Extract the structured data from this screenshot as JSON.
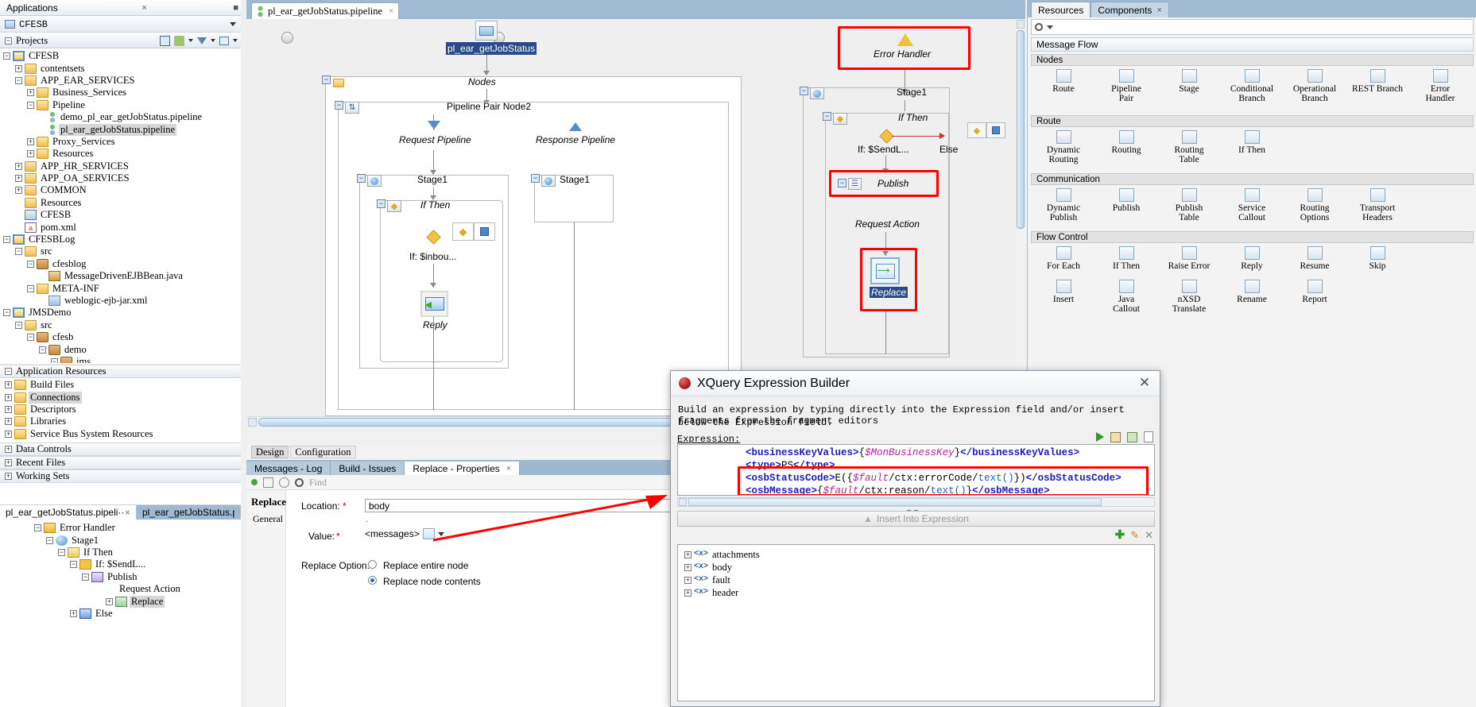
{
  "app": {
    "panel_title": "Applications",
    "selected_application": "CFESB",
    "projects_label": "Projects",
    "toolbar_icons": [
      "search-icon",
      "refresh-icon",
      "filter-icon",
      "view-options-icon"
    ]
  },
  "project_tree": [
    {
      "depth": 0,
      "exp": "-",
      "icon": "project-icon",
      "label": "CFESB",
      "selected": false
    },
    {
      "depth": 1,
      "exp": "+",
      "icon": "folder-icon",
      "label": "contentsets",
      "selected": false
    },
    {
      "depth": 1,
      "exp": "-",
      "icon": "folder-icon",
      "label": "APP_EAR_SERVICES",
      "selected": false
    },
    {
      "depth": 2,
      "exp": "+",
      "icon": "folder-icon",
      "label": "Business_Services",
      "selected": false
    },
    {
      "depth": 2,
      "exp": "-",
      "icon": "folder-icon",
      "label": "Pipeline",
      "selected": false
    },
    {
      "depth": 3,
      "exp": "",
      "icon": "pipeline-file-icon",
      "label": "demo_pl_ear_getJobStatus.pipeline",
      "selected": false
    },
    {
      "depth": 3,
      "exp": "",
      "icon": "pipeline-file-icon",
      "label": "pl_ear_getJobStatus.pipeline",
      "selected": true
    },
    {
      "depth": 2,
      "exp": "+",
      "icon": "folder-icon",
      "label": "Proxy_Services",
      "selected": false
    },
    {
      "depth": 2,
      "exp": "+",
      "icon": "folder-icon",
      "label": "Resources",
      "selected": false
    },
    {
      "depth": 1,
      "exp": "+",
      "icon": "folder-icon",
      "label": "APP_HR_SERVICES",
      "selected": false
    },
    {
      "depth": 1,
      "exp": "+",
      "icon": "folder-icon",
      "label": "APP_OA_SERVICES",
      "selected": false
    },
    {
      "depth": 1,
      "exp": "+",
      "icon": "folder-icon",
      "label": "COMMON",
      "selected": false
    },
    {
      "depth": 1,
      "exp": "",
      "icon": "folder-icon",
      "label": "Resources",
      "selected": false
    },
    {
      "depth": 1,
      "exp": "",
      "icon": "servicebus-icon",
      "label": "CFESB",
      "selected": false
    },
    {
      "depth": 1,
      "exp": "",
      "icon": "maven-icon",
      "label": "pom.xml",
      "selected": false
    },
    {
      "depth": 0,
      "exp": "-",
      "icon": "project-icon",
      "label": "CFESBLog",
      "selected": false
    },
    {
      "depth": 1,
      "exp": "-",
      "icon": "folder-icon",
      "label": "src",
      "selected": false
    },
    {
      "depth": 2,
      "exp": "-",
      "icon": "package-icon",
      "label": "cfesblog",
      "selected": false
    },
    {
      "depth": 3,
      "exp": "",
      "icon": "java-icon",
      "label": "MessageDrivenEJBBean.java",
      "selected": false
    },
    {
      "depth": 2,
      "exp": "-",
      "icon": "folder-icon",
      "label": "META-INF",
      "selected": false
    },
    {
      "depth": 3,
      "exp": "",
      "icon": "xml-icon",
      "label": "weblogic-ejb-jar.xml",
      "selected": false
    },
    {
      "depth": 0,
      "exp": "-",
      "icon": "project-icon",
      "label": "JMSDemo",
      "selected": false
    },
    {
      "depth": 1,
      "exp": "-",
      "icon": "folder-icon",
      "label": "src",
      "selected": false
    },
    {
      "depth": 2,
      "exp": "-",
      "icon": "package-icon",
      "label": "cfesb",
      "selected": false
    },
    {
      "depth": 3,
      "exp": "-",
      "icon": "package-icon",
      "label": "demo",
      "selected": false
    },
    {
      "depth": 4,
      "exp": "-",
      "icon": "package-icon",
      "label": "jms",
      "selected": false
    }
  ],
  "app_resources": {
    "title": "Application Resources",
    "items": [
      {
        "exp": "+",
        "icon": "folder-icon",
        "label": "Build Files",
        "selected": false
      },
      {
        "exp": "+",
        "icon": "folder-icon",
        "label": "Connections",
        "selected": true
      },
      {
        "exp": "+",
        "icon": "folder-icon",
        "label": "Descriptors",
        "selected": false
      },
      {
        "exp": "+",
        "icon": "folder-icon",
        "label": "Libraries",
        "selected": false
      },
      {
        "exp": "+",
        "icon": "folder-icon",
        "label": "Service Bus System Resources",
        "selected": false
      }
    ]
  },
  "collapsed_panels": [
    "Data Controls",
    "Recent Files",
    "Working Sets"
  ],
  "structure": {
    "tabs": [
      {
        "label": "pl_ear_getJobStatus.pipeli···",
        "active": true,
        "closable": true
      },
      {
        "label": "pl_ear_getJobStatus.pipeline···",
        "active": false,
        "closable": false
      }
    ],
    "nodes": [
      {
        "depth": 1,
        "exp": "-",
        "icon": "error-handler-icon",
        "label": "Error Handler",
        "selected": false
      },
      {
        "depth": 2,
        "exp": "-",
        "icon": "stage-icon",
        "label": "Stage1",
        "selected": false
      },
      {
        "depth": 3,
        "exp": "-",
        "icon": "if-then-icon",
        "label": "If Then",
        "selected": false
      },
      {
        "depth": 4,
        "exp": "-",
        "icon": "condition-icon",
        "label": "If: $SendL...",
        "selected": false
      },
      {
        "depth": 5,
        "exp": "-",
        "icon": "publish-icon",
        "label": "Publish",
        "selected": false
      },
      {
        "depth": 6,
        "exp": "",
        "icon": "",
        "label": "Request Action",
        "selected": false
      },
      {
        "depth": 7,
        "exp": "+",
        "icon": "replace-icon",
        "label": "Replace",
        "selected": true
      },
      {
        "depth": 4,
        "exp": "+",
        "icon": "else-icon",
        "label": "Else",
        "selected": false
      }
    ]
  },
  "editor": {
    "tab_label": "pl_ear_getJobStatus.pipeline",
    "tab_icon": "pipeline-file-icon",
    "design_tabs": [
      {
        "label": "Design",
        "active": true
      },
      {
        "label": "Configuration",
        "active": false
      }
    ]
  },
  "diagram": {
    "service_name": "pl_ear_getJobStatus",
    "nodes_label": "Nodes",
    "pipeline_pair_label": "Pipeline Pair Node2",
    "request_pipeline_label": "Request Pipeline",
    "response_pipeline_label": "Response Pipeline",
    "request_stage_label": "Stage1",
    "response_stage_label": "Stage1",
    "if_then_label": "If Then",
    "if_condition_label": "If: $inbou...",
    "reply_label": "Reply",
    "error_handler_label": "Error Handler",
    "eh_stage_label": "Stage1",
    "eh_if_then_label": "If Then",
    "eh_if_condition_label": "If: $SendL...",
    "eh_else_label": "Else",
    "eh_publish_label": "Publish",
    "eh_request_action_label": "Request Action",
    "eh_replace_label": "Replace",
    "highlight_color": "#ff0000"
  },
  "properties": {
    "tabs": [
      {
        "label": "Messages - Log",
        "active": false
      },
      {
        "label": "Build - Issues",
        "active": false
      },
      {
        "label": "Replace - Properties",
        "active": true
      }
    ],
    "find_placeholder": "Find",
    "section_title": "Replace",
    "side_tab": "General",
    "location_label": "Location:",
    "location_required": "*",
    "location_value": "body",
    "value_label": "Value:",
    "value_required": "*",
    "value_content": "<messages>",
    "replace_option_label": "Replace Option:",
    "options": [
      {
        "label": "Replace entire node",
        "selected": false
      },
      {
        "label": "Replace node contents",
        "selected": true
      }
    ]
  },
  "palette": {
    "tabs": [
      {
        "label": "Resources",
        "active": true
      },
      {
        "label": "Components",
        "active": false
      }
    ],
    "search_placeholder": "",
    "section_title": "Message Flow",
    "categories": [
      {
        "name": "Nodes",
        "items": [
          {
            "label": "Route",
            "icon": "route-icon"
          },
          {
            "label": "Pipeline\nPair",
            "icon": "pipeline-pair-icon"
          },
          {
            "label": "Stage",
            "icon": "stage-icon"
          },
          {
            "label": "Conditional\nBranch",
            "icon": "conditional-branch-icon"
          },
          {
            "label": "Operational\nBranch",
            "icon": "operational-branch-icon"
          },
          {
            "label": "REST Branch",
            "icon": "rest-branch-icon"
          },
          {
            "label": "Error\nHandler",
            "icon": "error-handler-icon"
          }
        ]
      },
      {
        "name": "Route",
        "items": [
          {
            "label": "Dynamic\nRouting",
            "icon": "dynamic-routing-icon"
          },
          {
            "label": "Routing",
            "icon": "routing-icon"
          },
          {
            "label": "Routing\nTable",
            "icon": "routing-table-icon"
          },
          {
            "label": "If Then",
            "icon": "if-then-icon"
          }
        ]
      },
      {
        "name": "Communication",
        "items": [
          {
            "label": "Dynamic\nPublish",
            "icon": "dynamic-publish-icon"
          },
          {
            "label": "Publish",
            "icon": "publish-icon"
          },
          {
            "label": "Publish\nTable",
            "icon": "publish-table-icon"
          },
          {
            "label": "Service\nCallout",
            "icon": "service-callout-icon"
          },
          {
            "label": "Routing\nOptions",
            "icon": "routing-options-icon"
          },
          {
            "label": "Transport\nHeaders",
            "icon": "transport-headers-icon"
          }
        ]
      },
      {
        "name": "Flow Control",
        "items": [
          {
            "label": "For Each",
            "icon": "for-each-icon"
          },
          {
            "label": "If Then",
            "icon": "if-then-icon"
          },
          {
            "label": "Raise Error",
            "icon": "raise-error-icon"
          },
          {
            "label": "Reply",
            "icon": "reply-icon"
          },
          {
            "label": "Resume",
            "icon": "resume-icon"
          },
          {
            "label": "Skip",
            "icon": "skip-icon"
          }
        ]
      },
      {
        "name": "",
        "items": [
          {
            "label": "Insert",
            "icon": "insert-icon"
          },
          {
            "label": "Java\nCallout",
            "icon": "java-callout-icon"
          },
          {
            "label": "nXSD\nTranslate",
            "icon": "nxsd-translate-icon"
          },
          {
            "label": "Rename",
            "icon": "rename-icon"
          },
          {
            "label": "Report",
            "icon": "report-icon"
          }
        ]
      }
    ]
  },
  "modal": {
    "title": "XQuery Expression Builder",
    "icon": "oracle-icon",
    "close_label": "✕",
    "description_line1": "Build an expression by typing directly into the Expression field and/or insert fragments from the fragment editors",
    "description_line2": "below the Expression field.",
    "expression_label": "Expression:",
    "toolbar_icons": [
      "run-icon",
      "copy-icon",
      "paste-icon",
      "clipboard-icon"
    ],
    "code_lines": [
      {
        "text": "<businessKeyValues>{$MonBusinessKey}</businessKeyValues>",
        "highlight": false
      },
      {
        "text": "<type>PS</type>",
        "highlight": false
      },
      {
        "text": "<osbStatusCode>E({$fault/ctx:errorCode/text()})</osbStatusCode>",
        "highlight": true
      },
      {
        "text": "<osbMessage>{$fault/ctx:reason/text()}</osbMessage>",
        "highlight": true
      }
    ],
    "insert_button_label": "Insert Into Expression",
    "fragment_actions": [
      "add-icon",
      "edit-icon",
      "delete-icon"
    ],
    "fragment_tree": [
      {
        "exp": "+",
        "icon": "xml-node-icon",
        "label": "attachments"
      },
      {
        "exp": "+",
        "icon": "xml-node-icon",
        "label": "body"
      },
      {
        "exp": "+",
        "icon": "xml-node-icon",
        "label": "fault"
      },
      {
        "exp": "+",
        "icon": "xml-node-icon",
        "label": "header"
      }
    ]
  }
}
